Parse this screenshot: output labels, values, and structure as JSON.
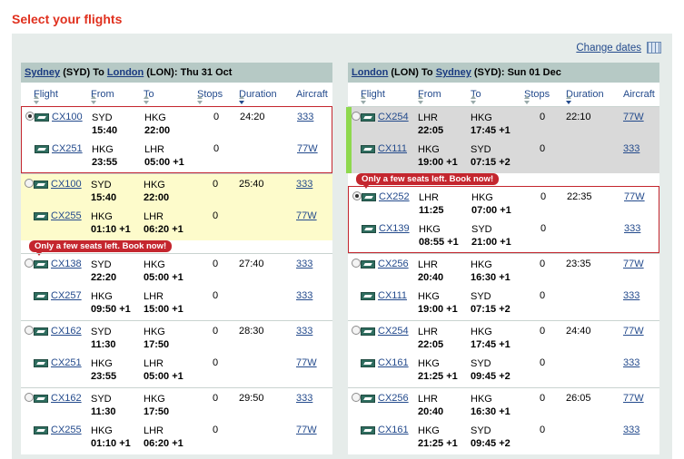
{
  "page_title": "Select your flights",
  "change_dates": "Change dates",
  "col_headers": {
    "flight": "Flight",
    "from": "From",
    "to": "To",
    "stops": "Stops",
    "duration": "Duration",
    "aircraft": "Aircraft"
  },
  "badge_text": "Only a few seats left. Book now!",
  "outbound": {
    "from_city": "Sydney",
    "from_code": "(SYD)",
    "sep": "To",
    "to_city": "London",
    "to_code": "(LON):",
    "date": "Thu 31 Oct",
    "options": [
      {
        "selected": true,
        "style": "sel",
        "legs": [
          {
            "flight": "CX100",
            "from": "SYD",
            "dep": "15:40",
            "to": "HKG",
            "arr": "22:00",
            "stops": "0",
            "duration": "24:20",
            "aircraft": "333"
          },
          {
            "flight": "CX251",
            "from": "HKG",
            "dep": "23:55",
            "to": "LHR",
            "arr": "05:00 +1",
            "stops": "0",
            "duration": "",
            "aircraft": "77W"
          }
        ]
      },
      {
        "selected": false,
        "style": "yel",
        "legs": [
          {
            "flight": "CX100",
            "from": "SYD",
            "dep": "15:40",
            "to": "HKG",
            "arr": "22:00",
            "stops": "0",
            "duration": "25:40",
            "aircraft": "333"
          },
          {
            "flight": "CX255",
            "from": "HKG",
            "dep": "01:10 +1",
            "to": "LHR",
            "arr": "06:20 +1",
            "stops": "0",
            "duration": "",
            "aircraft": "77W"
          }
        ]
      },
      {
        "selected": false,
        "badge": true,
        "legs": [
          {
            "flight": "CX138",
            "from": "SYD",
            "dep": "22:20",
            "to": "HKG",
            "arr": "05:00 +1",
            "stops": "0",
            "duration": "27:40",
            "aircraft": "333"
          },
          {
            "flight": "CX257",
            "from": "HKG",
            "dep": "09:50 +1",
            "to": "LHR",
            "arr": "15:00 +1",
            "stops": "0",
            "duration": "",
            "aircraft": "333"
          }
        ]
      },
      {
        "selected": false,
        "legs": [
          {
            "flight": "CX162",
            "from": "SYD",
            "dep": "11:30",
            "to": "HKG",
            "arr": "17:50",
            "stops": "0",
            "duration": "28:30",
            "aircraft": "333"
          },
          {
            "flight": "CX251",
            "from": "HKG",
            "dep": "23:55",
            "to": "LHR",
            "arr": "05:00 +1",
            "stops": "0",
            "duration": "",
            "aircraft": "77W"
          }
        ]
      },
      {
        "selected": false,
        "legs": [
          {
            "flight": "CX162",
            "from": "SYD",
            "dep": "11:30",
            "to": "HKG",
            "arr": "17:50",
            "stops": "0",
            "duration": "29:50",
            "aircraft": "333"
          },
          {
            "flight": "CX255",
            "from": "HKG",
            "dep": "01:10 +1",
            "to": "LHR",
            "arr": "06:20 +1",
            "stops": "0",
            "duration": "",
            "aircraft": "77W"
          }
        ]
      }
    ]
  },
  "inbound": {
    "from_city": "London",
    "from_code": "(LON)",
    "sep": "To",
    "to_city": "Sydney",
    "to_code": "(SYD):",
    "date": "Sun 01 Dec",
    "options": [
      {
        "selected": false,
        "style": "gray",
        "bar": true,
        "legs": [
          {
            "flight": "CX254",
            "from": "LHR",
            "dep": "22:05",
            "to": "HKG",
            "arr": "17:45 +1",
            "stops": "0",
            "duration": "22:10",
            "aircraft": "77W"
          },
          {
            "flight": "CX111",
            "from": "HKG",
            "dep": "19:00 +1",
            "to": "SYD",
            "arr": "07:15 +2",
            "stops": "0",
            "duration": "",
            "aircraft": "333"
          }
        ]
      },
      {
        "selected": true,
        "style": "sel",
        "badge": true,
        "legs": [
          {
            "flight": "CX252",
            "from": "LHR",
            "dep": "11:25",
            "to": "HKG",
            "arr": "07:00 +1",
            "stops": "0",
            "duration": "22:35",
            "aircraft": "77W"
          },
          {
            "flight": "CX139",
            "from": "HKG",
            "dep": "08:55 +1",
            "to": "SYD",
            "arr": "21:00 +1",
            "stops": "0",
            "duration": "",
            "aircraft": "333"
          }
        ]
      },
      {
        "selected": false,
        "legs": [
          {
            "flight": "CX256",
            "from": "LHR",
            "dep": "20:40",
            "to": "HKG",
            "arr": "16:30 +1",
            "stops": "0",
            "duration": "23:35",
            "aircraft": "77W"
          },
          {
            "flight": "CX111",
            "from": "HKG",
            "dep": "19:00 +1",
            "to": "SYD",
            "arr": "07:15 +2",
            "stops": "0",
            "duration": "",
            "aircraft": "333"
          }
        ]
      },
      {
        "selected": false,
        "legs": [
          {
            "flight": "CX254",
            "from": "LHR",
            "dep": "22:05",
            "to": "HKG",
            "arr": "17:45 +1",
            "stops": "0",
            "duration": "24:40",
            "aircraft": "77W"
          },
          {
            "flight": "CX161",
            "from": "HKG",
            "dep": "21:25 +1",
            "to": "SYD",
            "arr": "09:45 +2",
            "stops": "0",
            "duration": "",
            "aircraft": "333"
          }
        ]
      },
      {
        "selected": false,
        "legs": [
          {
            "flight": "CX256",
            "from": "LHR",
            "dep": "20:40",
            "to": "HKG",
            "arr": "16:30 +1",
            "stops": "0",
            "duration": "26:05",
            "aircraft": "77W"
          },
          {
            "flight": "CX161",
            "from": "HKG",
            "dep": "21:25 +1",
            "to": "SYD",
            "arr": "09:45 +2",
            "stops": "0",
            "duration": "",
            "aircraft": "333"
          }
        ]
      }
    ]
  }
}
